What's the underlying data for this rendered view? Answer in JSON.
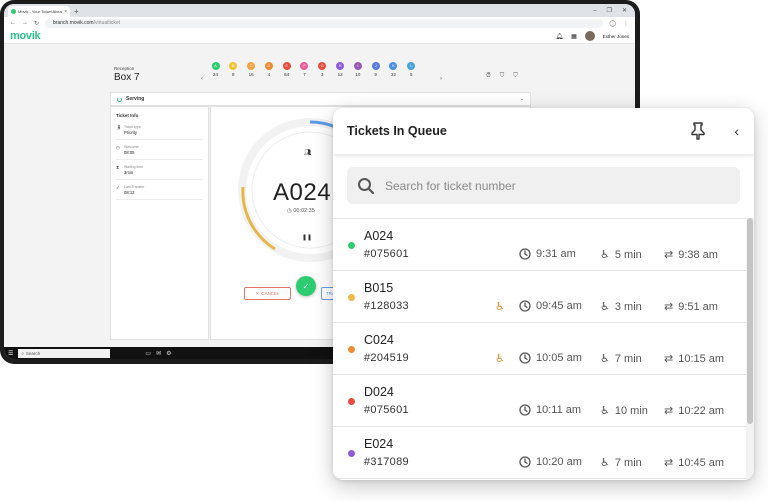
{
  "browser": {
    "tab_title": "Movik - Your Ticket Ahead",
    "url_host": "branch.movik.com",
    "url_path": "/virtualticket"
  },
  "app": {
    "logo": "movik",
    "user_name": "Esther Jones"
  },
  "box": {
    "reception_label": "Reception",
    "title": "Box 7"
  },
  "queue_counters": [
    {
      "letter": "A",
      "value": "24",
      "color": "#2ecc71"
    },
    {
      "letter": "B",
      "value": "8",
      "color": "#f1c232"
    },
    {
      "letter": "C",
      "value": "16",
      "color": "#f6a243"
    },
    {
      "letter": "D",
      "value": "4",
      "color": "#f28b30"
    },
    {
      "letter": "E",
      "value": "64",
      "color": "#e74c3c"
    },
    {
      "letter": "F",
      "value": "7",
      "color": "#ec5f9a"
    },
    {
      "letter": "G",
      "value": "3",
      "color": "#e74c3c"
    },
    {
      "letter": "H",
      "value": "12",
      "color": "#8e5cd9"
    },
    {
      "letter": "I",
      "value": "10",
      "color": "#9b59b6"
    },
    {
      "letter": "J",
      "value": "9",
      "color": "#5b7bd9"
    },
    {
      "letter": "K",
      "value": "32",
      "color": "#4a90e2"
    },
    {
      "letter": "L",
      "value": "5",
      "color": "#4aa3df"
    }
  ],
  "serving": {
    "label": "Serving"
  },
  "ticket_info": {
    "title": "Ticket Info",
    "rows": [
      {
        "label": "Ticket type",
        "value": "Priority",
        "icon": "person-icon"
      },
      {
        "label": "Welcome",
        "value": "08:05",
        "icon": "clock-icon"
      },
      {
        "label": "Waiting time",
        "value": "3min",
        "icon": "hourglass-icon"
      },
      {
        "label": "Last Transfer",
        "value": "08:12",
        "icon": "check-icon"
      }
    ]
  },
  "current_ticket": {
    "number": "A024",
    "timer": "00:02:35",
    "cancel_label": "CANCEL",
    "transfer_label": "TRA"
  },
  "taskbar": {
    "search_label": "Search"
  },
  "queue_panel": {
    "title": "Tickets In Queue",
    "search_placeholder": "Search for ticket number",
    "tickets": [
      {
        "number": "A024",
        "code": "#075601",
        "color": "#2ecc71",
        "accessible": false,
        "time": "9:31 am",
        "wait": "5 min",
        "eta": "9:38 am"
      },
      {
        "number": "B015",
        "code": "#128033",
        "color": "#f0b94a",
        "accessible": true,
        "time": "09:45 am",
        "wait": "3 min",
        "eta": "9:51 am"
      },
      {
        "number": "C024",
        "code": "#204519",
        "color": "#f28b30",
        "accessible": true,
        "time": "10:05 am",
        "wait": "7 min",
        "eta": "10:15 am"
      },
      {
        "number": "D024",
        "code": "#075601",
        "color": "#e74c3c",
        "accessible": false,
        "time": "10:11 am",
        "wait": "10 min",
        "eta": "10:22 am"
      },
      {
        "number": "E024",
        "code": "#317089",
        "color": "#8e5cd9",
        "accessible": false,
        "time": "10:20 am",
        "wait": "7 min",
        "eta": "10:45 am"
      }
    ]
  }
}
